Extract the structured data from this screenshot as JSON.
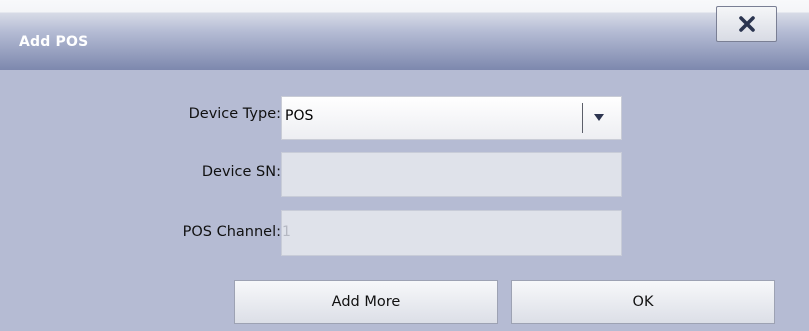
{
  "dialog": {
    "title": "Add POS",
    "close_icon": "close-x-icon"
  },
  "form": {
    "device_type": {
      "label": "Device Type:",
      "value": "POS",
      "dropdown_icon": "triangle-down-icon"
    },
    "device_sn": {
      "label": "Device SN:",
      "value": ""
    },
    "pos_channel": {
      "label": "POS Channel:",
      "value": "1"
    }
  },
  "buttons": {
    "add_more_label": "Add More",
    "ok_label": "OK"
  }
}
